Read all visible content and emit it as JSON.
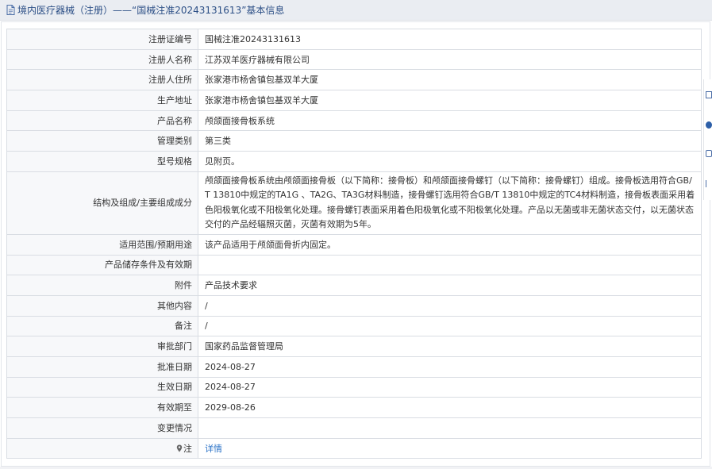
{
  "header": {
    "title": "境内医疗器械（注册）——“国械注准20243131613”基本信息"
  },
  "rows": [
    {
      "label": "注册证编号",
      "value": "国械注准20243131613"
    },
    {
      "label": "注册人名称",
      "value": "江苏双羊医疗器械有限公司"
    },
    {
      "label": "注册人住所",
      "value": "张家港市杨舍镇包基双羊大厦"
    },
    {
      "label": "生产地址",
      "value": "张家港市杨舍镇包基双羊大厦"
    },
    {
      "label": "产品名称",
      "value": "颅颌面接骨板系统"
    },
    {
      "label": "管理类别",
      "value": "第三类"
    },
    {
      "label": "型号规格",
      "value": "见附页。"
    },
    {
      "label": "结构及组成/主要组成成分",
      "value": "颅颌面接骨板系统由颅颌面接骨板（以下简称：接骨板）和颅颌面接骨螺钉（以下简称：接骨螺钉）组成。接骨板选用符合GB/T 13810中规定的TA1G 、TA2G、TA3G材料制造，接骨螺钉选用符合GB/T 13810中规定的TC4材料制造，接骨板表面采用着色阳极氧化或不阳极氧化处理。接骨螺钉表面采用着色阳极氧化或不阳极氧化处理。产品以无菌或非无菌状态交付，以无菌状态交付的产品经辐照灭菌，灭菌有效期为5年。"
    },
    {
      "label": "适用范围/预期用途",
      "value": "该产品适用于颅颌面骨折内固定。"
    },
    {
      "label": "产品储存条件及有效期",
      "value": ""
    },
    {
      "label": "附件",
      "value": "产品技术要求"
    },
    {
      "label": "其他内容",
      "value": "/"
    },
    {
      "label": "备注",
      "value": "/"
    },
    {
      "label": "审批部门",
      "value": "国家药品监督管理局"
    },
    {
      "label": "批准日期",
      "value": "2024-08-27"
    },
    {
      "label": "生效日期",
      "value": "2024-08-27"
    },
    {
      "label": "有效期至",
      "value": "2029-08-26"
    },
    {
      "label": "变更情况",
      "value": ""
    },
    {
      "label": "注",
      "value": "详情"
    }
  ],
  "icons": {
    "header": "document-icon",
    "note": "pin-icon"
  },
  "colors": {
    "header_bg": "#eaedf2",
    "header_text": "#2c4f86",
    "label_bg": "#f7f8fa",
    "border": "#d9dde3",
    "link": "#2b73c7"
  }
}
